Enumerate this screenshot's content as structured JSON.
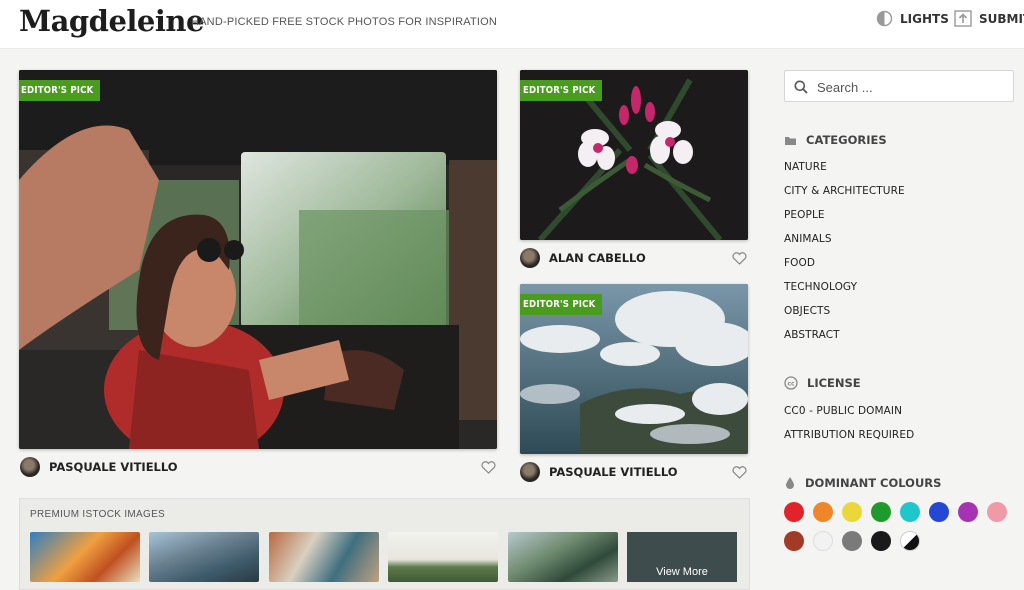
{
  "header": {
    "logo": "Magdeleine",
    "tagline": "HAND-PICKED FREE STOCK PHOTOS FOR INSPIRATION",
    "lights_label": "LIGHTS",
    "submit_label": "SUBMIT"
  },
  "photos": [
    {
      "badge": "EDITOR'S PICK",
      "author": "PASQUALE VITIELLO"
    },
    {
      "badge": "EDITOR'S PICK",
      "author": "ALAN CABELLO"
    },
    {
      "badge": "EDITOR'S PICK",
      "author": "PASQUALE VITIELLO"
    }
  ],
  "premium": {
    "title": "PREMIUM ISTOCK IMAGES",
    "view_more": "View More"
  },
  "sidebar": {
    "search_placeholder": "Search ...",
    "categories_title": "CATEGORIES",
    "categories": [
      "NATURE",
      "CITY & ARCHITECTURE",
      "PEOPLE",
      "ANIMALS",
      "FOOD",
      "TECHNOLOGY",
      "OBJECTS",
      "ABSTRACT"
    ],
    "license_title": "LICENSE",
    "licenses": [
      "CC0 - PUBLIC DOMAIN",
      "ATTRIBUTION REQUIRED"
    ],
    "colours_title": "DOMINANT COLOURS",
    "colours": [
      "#e0242a",
      "#f0862a",
      "#ecd73a",
      "#1f9b2e",
      "#1fc6cc",
      "#2447d6",
      "#a533b3",
      "#f09aa8",
      "#a33a26",
      "#f2f2f2",
      "#7a7a7a",
      "#1a1a1a",
      "bw"
    ]
  },
  "colors": {
    "badge": "#4a9c1e",
    "background": "#f4f4f2"
  }
}
